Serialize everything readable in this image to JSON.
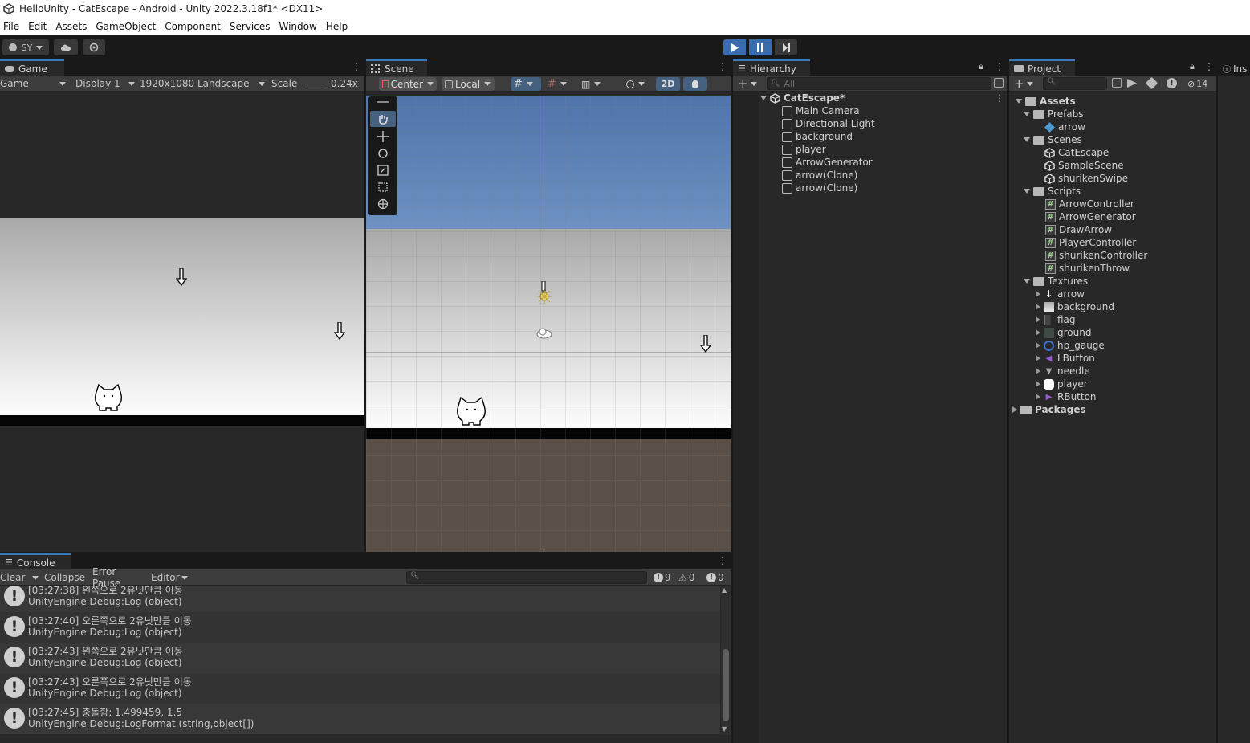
{
  "window": {
    "title": "HelloUnity - CatEscape - Android - Unity 2022.3.18f1* <DX11>"
  },
  "menu": [
    "File",
    "Edit",
    "Assets",
    "GameObject",
    "Component",
    "Services",
    "Window",
    "Help"
  ],
  "toolbar": {
    "account": "SY"
  },
  "game": {
    "tab": "Game",
    "view_mode": "Game",
    "display": "Display 1",
    "resolution": "1920x1080 Landscape",
    "scale_label": "Scale",
    "scale_value": "0.24x"
  },
  "scene": {
    "tab": "Scene",
    "pivot": "Center",
    "space": "Local",
    "mode_2d": "2D"
  },
  "hierarchy": {
    "tab": "Hierarchy",
    "search_placeholder": "All",
    "scene_name": "CatEscape*",
    "items": [
      "Main Camera",
      "Directional Light",
      "background",
      "player",
      "ArrowGenerator",
      "arrow(Clone)",
      "arrow(Clone)"
    ]
  },
  "project": {
    "tab": "Project",
    "hidden_count": "14",
    "assets": "Assets",
    "prefabs": {
      "label": "Prefabs",
      "items": [
        "arrow"
      ]
    },
    "scenes": {
      "label": "Scenes",
      "items": [
        "CatEscape",
        "SampleScene",
        "shurikenSwipe"
      ]
    },
    "scripts": {
      "label": "Scripts",
      "items": [
        "ArrowController",
        "ArrowGenerator",
        "DrawArrow",
        "PlayerController",
        "shurikenController",
        "shurikenThrow"
      ]
    },
    "textures": {
      "label": "Textures",
      "items": [
        "arrow",
        "background",
        "flag",
        "ground",
        "hp_gauge",
        "LButton",
        "needle",
        "player",
        "RButton"
      ]
    },
    "packages": "Packages"
  },
  "inspector": {
    "tab": "Ins"
  },
  "console": {
    "tab": "Console",
    "clear": "Clear",
    "collapse": "Collapse",
    "error_pause": "Error Pause",
    "editor": "Editor",
    "counts": {
      "log": "9",
      "warn": "0",
      "error": "0"
    },
    "logs": [
      {
        "line1": "[03:27:38] 왼쪽으로 2유닛만큼 이동",
        "line2": "UnityEngine.Debug:Log (object)"
      },
      {
        "line1": "[03:27:40] 오른쪽으로 2유닛만큼 이동",
        "line2": "UnityEngine.Debug:Log (object)"
      },
      {
        "line1": "[03:27:43] 왼쪽으로 2유닛만큼 이동",
        "line2": "UnityEngine.Debug:Log (object)"
      },
      {
        "line1": "[03:27:43] 오른쪽으로 2유닛만큼 이동",
        "line2": "UnityEngine.Debug:Log (object)"
      },
      {
        "line1": "[03:27:45] 충돌함: 1.499459, 1.5",
        "line2": "UnityEngine.Debug:LogFormat (string,object[])"
      }
    ]
  }
}
